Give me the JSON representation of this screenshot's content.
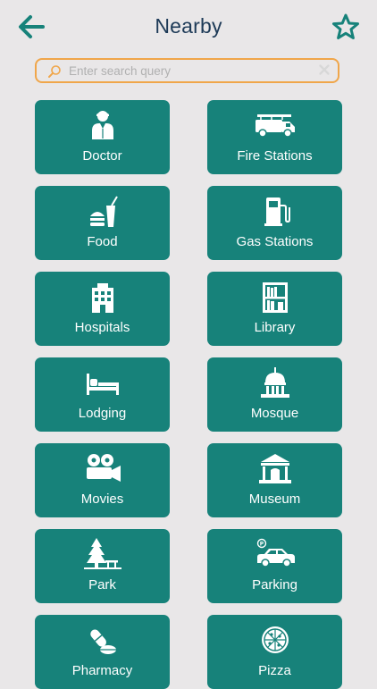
{
  "header": {
    "title": "Nearby",
    "back_icon": "arrow-left-icon",
    "favorite_icon": "star-outline-icon"
  },
  "search": {
    "placeholder": "Enter search query",
    "value": ""
  },
  "colors": {
    "tile": "#17827a",
    "accent": "#f0a64a",
    "title": "#1d3a57",
    "background": "#e9e7e8"
  },
  "tiles": [
    {
      "label": "Doctor",
      "icon": "doctor-icon"
    },
    {
      "label": "Fire Stations",
      "icon": "fire-truck-icon"
    },
    {
      "label": "Food",
      "icon": "food-icon"
    },
    {
      "label": "Gas Stations",
      "icon": "gas-pump-icon"
    },
    {
      "label": "Hospitals",
      "icon": "hospital-icon"
    },
    {
      "label": "Library",
      "icon": "library-icon"
    },
    {
      "label": "Lodging",
      "icon": "bed-icon"
    },
    {
      "label": "Mosque",
      "icon": "dome-icon"
    },
    {
      "label": "Movies",
      "icon": "movie-camera-icon"
    },
    {
      "label": "Museum",
      "icon": "museum-icon"
    },
    {
      "label": "Park",
      "icon": "tree-icon"
    },
    {
      "label": "Parking",
      "icon": "parking-car-icon"
    },
    {
      "label": "Pharmacy",
      "icon": "pills-icon"
    },
    {
      "label": "Pizza",
      "icon": "pizza-icon"
    }
  ]
}
